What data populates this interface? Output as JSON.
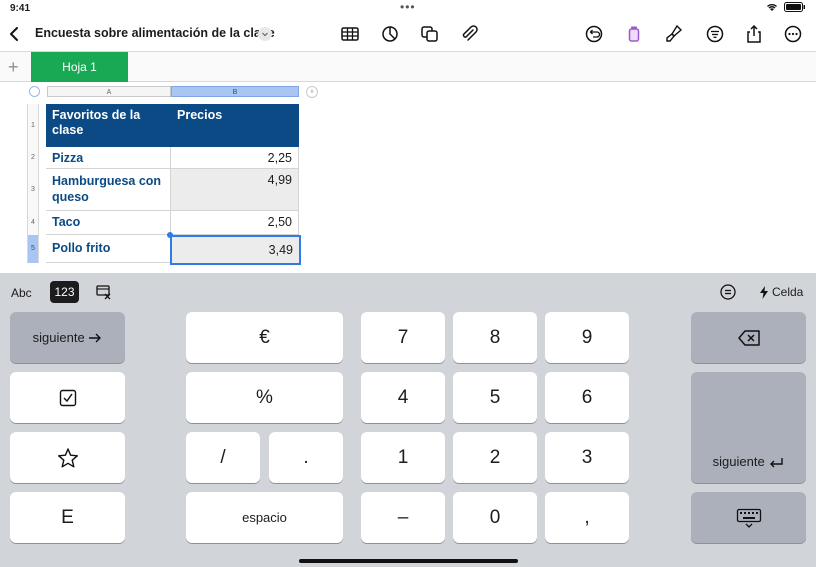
{
  "status": {
    "time": "9:41",
    "dots": "•••"
  },
  "toolbar": {
    "title": "Encuesta sobre alimentación de la clase",
    "icons": [
      "back-chevron-icon",
      "table-icon",
      "chart-icon",
      "shapes-icon",
      "attachment-icon",
      "undo-icon",
      "format-brush-icon",
      "paintbrush-icon",
      "filter-icon",
      "share-icon",
      "more-icon"
    ]
  },
  "tabs": {
    "add": "+",
    "sheet1": "Hoja 1"
  },
  "sheet": {
    "columns": [
      "A",
      "B"
    ],
    "rows": [
      "1",
      "2",
      "3",
      "4",
      "5"
    ],
    "header": [
      "Favoritos de la clase",
      "Precios"
    ],
    "data": [
      {
        "name": "Pizza",
        "price": "2,25"
      },
      {
        "name": "Hamburguesa con queso",
        "price": "4,99"
      },
      {
        "name": "Taco",
        "price": "2,50"
      },
      {
        "name": "Pollo frito",
        "price": "3,49"
      }
    ]
  },
  "keyboard": {
    "mode_abc": "Abc",
    "mode_123": "123",
    "celda": "Celda",
    "next": "siguiente",
    "euro": "€",
    "percent": "%",
    "slash": "/",
    "dot": ".",
    "space": "espacio",
    "e": "E",
    "digits": [
      "7",
      "8",
      "9",
      "4",
      "5",
      "6",
      "1",
      "2",
      "3",
      "–",
      "0",
      ","
    ],
    "next_return": "siguiente"
  }
}
